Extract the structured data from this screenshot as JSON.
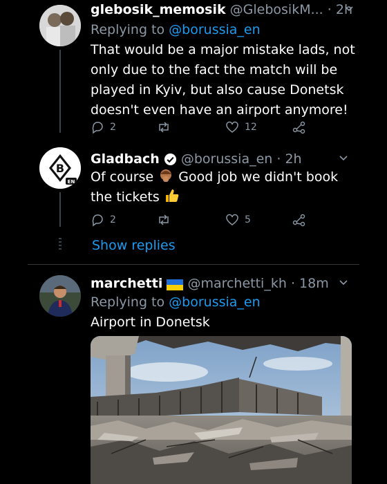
{
  "tweets": [
    {
      "display_name": "glebosik_memosik",
      "handle": "@GlebosikM...",
      "time": "· 2h",
      "replying_prefix": "Replying to",
      "replying_to": "@borussia_en",
      "lines": [
        "That would be a major mistake lads, not",
        "only due to the fact the match will be",
        "played in Kyiv, but also cause Donetsk",
        "doesn't even have an airport anymore!"
      ],
      "replies": "2",
      "retweets": "",
      "likes": "12"
    },
    {
      "display_name": "Gladbach",
      "handle": "@borussia_en",
      "time": "· 2h",
      "line1_a": "Of course",
      "line1_b": "Good job we didn't book",
      "line2": "the tickets",
      "replies": "2",
      "retweets": "",
      "likes": "5",
      "show_replies": "Show replies"
    },
    {
      "display_name": "marchetti",
      "handle": "@marchetti_kh",
      "time": "· 18m",
      "replying_prefix": "Replying to",
      "replying_to": "@borussia_en",
      "text": "Airport in Donetsk"
    }
  ],
  "colors": {
    "background": "#000000",
    "secondary_text": "#8b98a5",
    "link": "#1d9bf0",
    "verified": "#1d9bf0"
  },
  "icons": [
    "reply-icon",
    "retweet-icon",
    "like-icon",
    "share-icon",
    "verified-icon",
    "chevron-down-icon",
    "ukraine-flag-icon",
    "facepalm-emoji",
    "thumbs-up-emoji"
  ]
}
